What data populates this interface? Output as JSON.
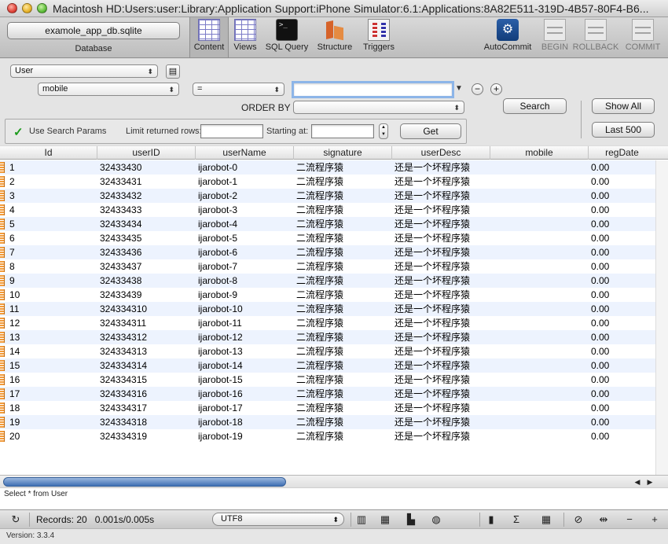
{
  "window": {
    "title": "Macintosh HD:Users:user:Library:Application Support:iPhone Simulator:6.1:Applications:8A82E511-319D-4B57-80F4-B6..."
  },
  "toolbar": {
    "database_file": "examole_app_db.sqlite",
    "database_label": "Database",
    "tools": [
      {
        "label": "Content",
        "icon": "grid-icon",
        "active": true
      },
      {
        "label": "Views",
        "icon": "grid-icon"
      },
      {
        "label": "SQL Query",
        "icon": "terminal-icon"
      },
      {
        "label": "Structure",
        "icon": "structure-icon"
      },
      {
        "label": "Triggers",
        "icon": "triggers-icon"
      },
      {
        "label": "AutoCommit",
        "icon": "gear-icon"
      },
      {
        "label": "BEGIN",
        "icon": "begin-icon",
        "disabled": true
      },
      {
        "label": "ROLLBACK",
        "icon": "rollback-icon",
        "disabled": true
      },
      {
        "label": "COMMIT",
        "icon": "commit-icon",
        "disabled": true
      }
    ]
  },
  "search": {
    "table": "User",
    "column": "mobile",
    "operator": "=",
    "value": "",
    "order_by_label": "ORDER BY",
    "order_by": "",
    "search_button": "Search",
    "show_all_button": "Show All",
    "last_500_button": "Last 500",
    "use_search_params": "Use Search Params",
    "limit_label": "Limit returned rows:",
    "limit_value": "",
    "starting_at_label": "Starting at:",
    "starting_at_value": "",
    "get_button": "Get"
  },
  "table": {
    "columns": [
      "Id",
      "userID",
      "userName",
      "signature",
      "userDesc",
      "mobile",
      "regDate"
    ],
    "rows": [
      [
        "1",
        "32433430",
        "ijarobot-0",
        "二流程序猿",
        "还是一个坏程序猿",
        "",
        "0.00"
      ],
      [
        "2",
        "32433431",
        "ijarobot-1",
        "二流程序猿",
        "还是一个坏程序猿",
        "",
        "0.00"
      ],
      [
        "3",
        "32433432",
        "ijarobot-2",
        "二流程序猿",
        "还是一个坏程序猿",
        "",
        "0.00"
      ],
      [
        "4",
        "32433433",
        "ijarobot-3",
        "二流程序猿",
        "还是一个坏程序猿",
        "",
        "0.00"
      ],
      [
        "5",
        "32433434",
        "ijarobot-4",
        "二流程序猿",
        "还是一个坏程序猿",
        "",
        "0.00"
      ],
      [
        "6",
        "32433435",
        "ijarobot-5",
        "二流程序猿",
        "还是一个坏程序猿",
        "",
        "0.00"
      ],
      [
        "7",
        "32433436",
        "ijarobot-6",
        "二流程序猿",
        "还是一个坏程序猿",
        "",
        "0.00"
      ],
      [
        "8",
        "32433437",
        "ijarobot-7",
        "二流程序猿",
        "还是一个坏程序猿",
        "",
        "0.00"
      ],
      [
        "9",
        "32433438",
        "ijarobot-8",
        "二流程序猿",
        "还是一个坏程序猿",
        "",
        "0.00"
      ],
      [
        "10",
        "32433439",
        "ijarobot-9",
        "二流程序猿",
        "还是一个坏程序猿",
        "",
        "0.00"
      ],
      [
        "11",
        "324334310",
        "ijarobot-10",
        "二流程序猿",
        "还是一个坏程序猿",
        "",
        "0.00"
      ],
      [
        "12",
        "324334311",
        "ijarobot-11",
        "二流程序猿",
        "还是一个坏程序猿",
        "",
        "0.00"
      ],
      [
        "13",
        "324334312",
        "ijarobot-12",
        "二流程序猿",
        "还是一个坏程序猿",
        "",
        "0.00"
      ],
      [
        "14",
        "324334313",
        "ijarobot-13",
        "二流程序猿",
        "还是一个坏程序猿",
        "",
        "0.00"
      ],
      [
        "15",
        "324334314",
        "ijarobot-14",
        "二流程序猿",
        "还是一个坏程序猿",
        "",
        "0.00"
      ],
      [
        "16",
        "324334315",
        "ijarobot-15",
        "二流程序猿",
        "还是一个坏程序猿",
        "",
        "0.00"
      ],
      [
        "17",
        "324334316",
        "ijarobot-16",
        "二流程序猿",
        "还是一个坏程序猿",
        "",
        "0.00"
      ],
      [
        "18",
        "324334317",
        "ijarobot-17",
        "二流程序猿",
        "还是一个坏程序猿",
        "",
        "0.00"
      ],
      [
        "19",
        "324334318",
        "ijarobot-18",
        "二流程序猿",
        "还是一个坏程序猿",
        "",
        "0.00"
      ],
      [
        "20",
        "324334319",
        "ijarobot-19",
        "二流程序猿",
        "还是一个坏程序猿",
        "",
        "0.00"
      ]
    ]
  },
  "query": {
    "text": "Select * from User"
  },
  "status": {
    "records": "Records: 20",
    "timing": "0.001s/0.005s",
    "encoding": "UTF8"
  },
  "footer": {
    "version": "Version: 3.3.4"
  },
  "colors": {
    "row_alt": "#edf3fe",
    "scroll_thumb": "#3f6fb4",
    "row_marker": "#f29b3a"
  }
}
